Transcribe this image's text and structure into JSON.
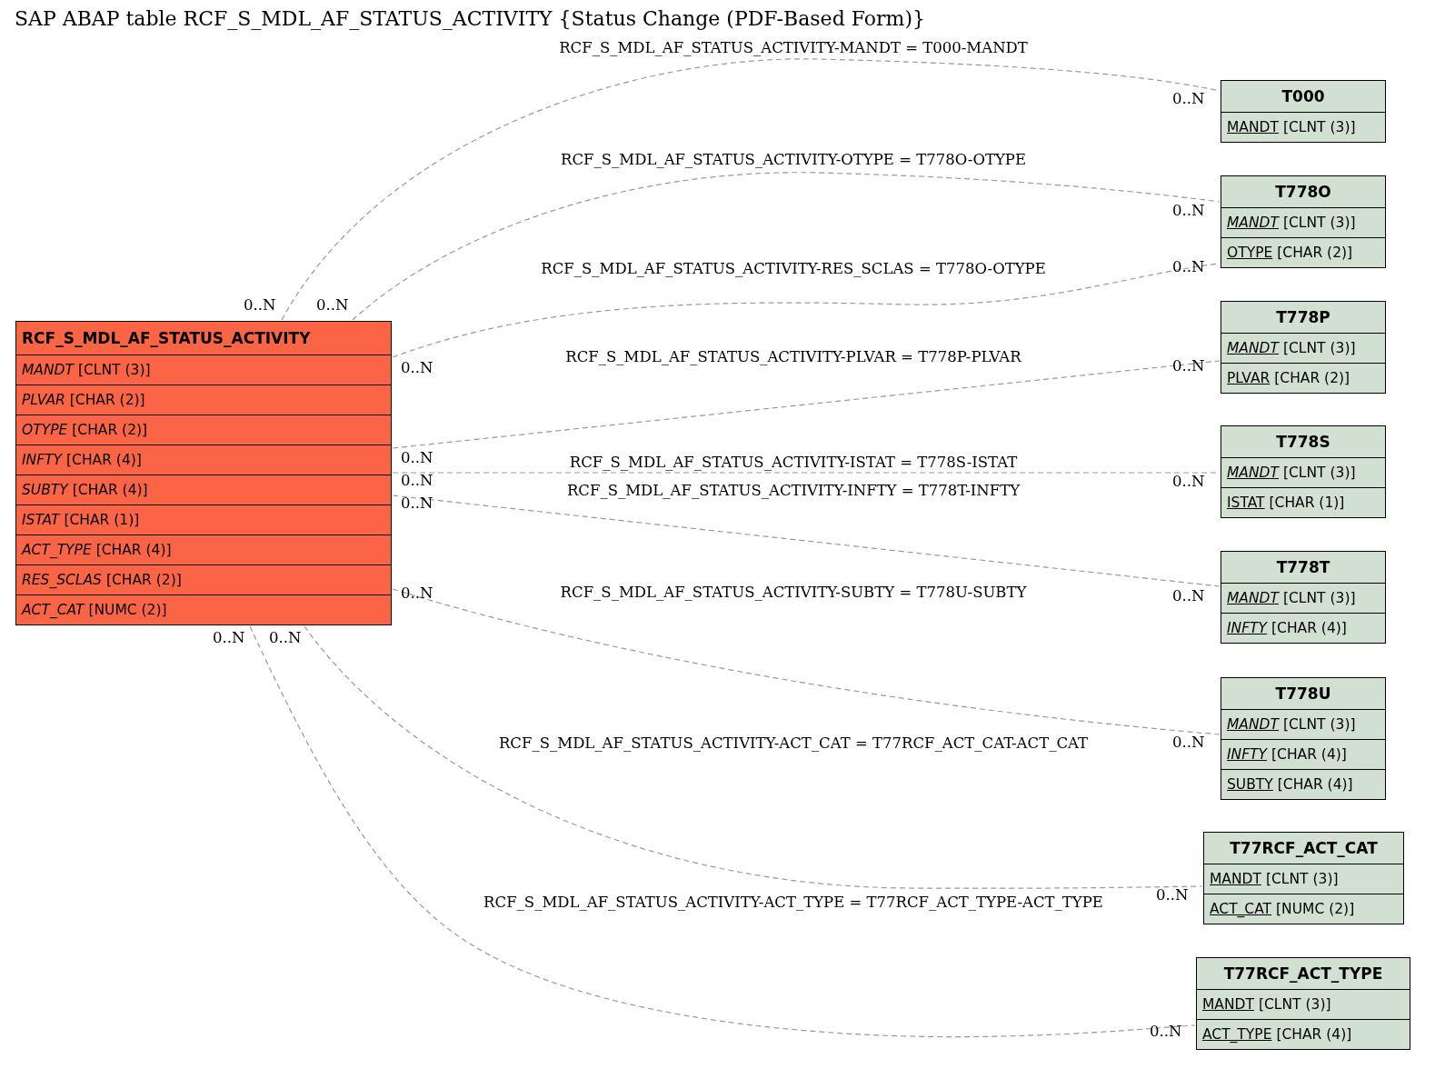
{
  "title": "SAP ABAP table RCF_S_MDL_AF_STATUS_ACTIVITY {Status Change (PDF-Based Form)}",
  "main_table": {
    "name": "RCF_S_MDL_AF_STATUS_ACTIVITY",
    "fields": [
      {
        "name": "MANDT",
        "type": "[CLNT (3)]",
        "key": false,
        "foreign": true
      },
      {
        "name": "PLVAR",
        "type": "[CHAR (2)]",
        "key": false,
        "foreign": true
      },
      {
        "name": "OTYPE",
        "type": "[CHAR (2)]",
        "key": false,
        "foreign": true
      },
      {
        "name": "INFTY",
        "type": "[CHAR (4)]",
        "key": false,
        "foreign": true
      },
      {
        "name": "SUBTY",
        "type": "[CHAR (4)]",
        "key": false,
        "foreign": true
      },
      {
        "name": "ISTAT",
        "type": "[CHAR (1)]",
        "key": false,
        "foreign": true
      },
      {
        "name": "ACT_TYPE",
        "type": "[CHAR (4)]",
        "key": false,
        "foreign": true
      },
      {
        "name": "RES_SCLAS",
        "type": "[CHAR (2)]",
        "key": false,
        "foreign": true
      },
      {
        "name": "ACT_CAT",
        "type": "[NUMC (2)]",
        "key": false,
        "foreign": true
      }
    ]
  },
  "related_tables": [
    {
      "name": "T000",
      "fields": [
        {
          "name": "MANDT",
          "type": "[CLNT (3)]",
          "key": true,
          "foreign": false
        }
      ]
    },
    {
      "name": "T778O",
      "fields": [
        {
          "name": "MANDT",
          "type": "[CLNT (3)]",
          "key": true,
          "foreign": true
        },
        {
          "name": "OTYPE",
          "type": "[CHAR (2)]",
          "key": true,
          "foreign": false
        }
      ]
    },
    {
      "name": "T778P",
      "fields": [
        {
          "name": "MANDT",
          "type": "[CLNT (3)]",
          "key": true,
          "foreign": true
        },
        {
          "name": "PLVAR",
          "type": "[CHAR (2)]",
          "key": true,
          "foreign": false
        }
      ]
    },
    {
      "name": "T778S",
      "fields": [
        {
          "name": "MANDT",
          "type": "[CLNT (3)]",
          "key": true,
          "foreign": true
        },
        {
          "name": "ISTAT",
          "type": "[CHAR (1)]",
          "key": true,
          "foreign": false
        }
      ]
    },
    {
      "name": "T778T",
      "fields": [
        {
          "name": "MANDT",
          "type": "[CLNT (3)]",
          "key": true,
          "foreign": true
        },
        {
          "name": "INFTY",
          "type": "[CHAR (4)]",
          "key": true,
          "foreign": true
        }
      ]
    },
    {
      "name": "T778U",
      "fields": [
        {
          "name": "MANDT",
          "type": "[CLNT (3)]",
          "key": true,
          "foreign": true
        },
        {
          "name": "INFTY",
          "type": "[CHAR (4)]",
          "key": true,
          "foreign": true
        },
        {
          "name": "SUBTY",
          "type": "[CHAR (4)]",
          "key": true,
          "foreign": false
        }
      ]
    },
    {
      "name": "T77RCF_ACT_CAT",
      "fields": [
        {
          "name": "MANDT",
          "type": "[CLNT (3)]",
          "key": true,
          "foreign": false
        },
        {
          "name": "ACT_CAT",
          "type": "[NUMC (2)]",
          "key": true,
          "foreign": false
        }
      ]
    },
    {
      "name": "T77RCF_ACT_TYPE",
      "fields": [
        {
          "name": "MANDT",
          "type": "[CLNT (3)]",
          "key": true,
          "foreign": false
        },
        {
          "name": "ACT_TYPE",
          "type": "[CHAR (4)]",
          "key": true,
          "foreign": false
        }
      ]
    }
  ],
  "relations": [
    {
      "label": "RCF_S_MDL_AF_STATUS_ACTIVITY-MANDT = T000-MANDT",
      "from_card": "0..N",
      "to_card": "0..N"
    },
    {
      "label": "RCF_S_MDL_AF_STATUS_ACTIVITY-OTYPE = T778O-OTYPE",
      "from_card": "0..N",
      "to_card": "0..N"
    },
    {
      "label": "RCF_S_MDL_AF_STATUS_ACTIVITY-RES_SCLAS = T778O-OTYPE",
      "from_card": "0..N",
      "to_card": "0..N"
    },
    {
      "label": "RCF_S_MDL_AF_STATUS_ACTIVITY-PLVAR = T778P-PLVAR",
      "from_card": "0..N",
      "to_card": "0..N"
    },
    {
      "label": "RCF_S_MDL_AF_STATUS_ACTIVITY-ISTAT = T778S-ISTAT",
      "from_card": "0..N",
      "to_card": "0..N"
    },
    {
      "label": "RCF_S_MDL_AF_STATUS_ACTIVITY-INFTY = T778T-INFTY",
      "from_card": "0..N",
      "to_card": "0..N"
    },
    {
      "label": "RCF_S_MDL_AF_STATUS_ACTIVITY-SUBTY = T778U-SUBTY",
      "from_card": "0..N",
      "to_card": "0..N"
    },
    {
      "label": "RCF_S_MDL_AF_STATUS_ACTIVITY-ACT_CAT = T77RCF_ACT_CAT-ACT_CAT",
      "from_card": "0..N",
      "to_card": "0..N"
    },
    {
      "label": "RCF_S_MDL_AF_STATUS_ACTIVITY-ACT_TYPE = T77RCF_ACT_TYPE-ACT_TYPE",
      "from_card": "0..N",
      "to_card": "0..N"
    }
  ]
}
